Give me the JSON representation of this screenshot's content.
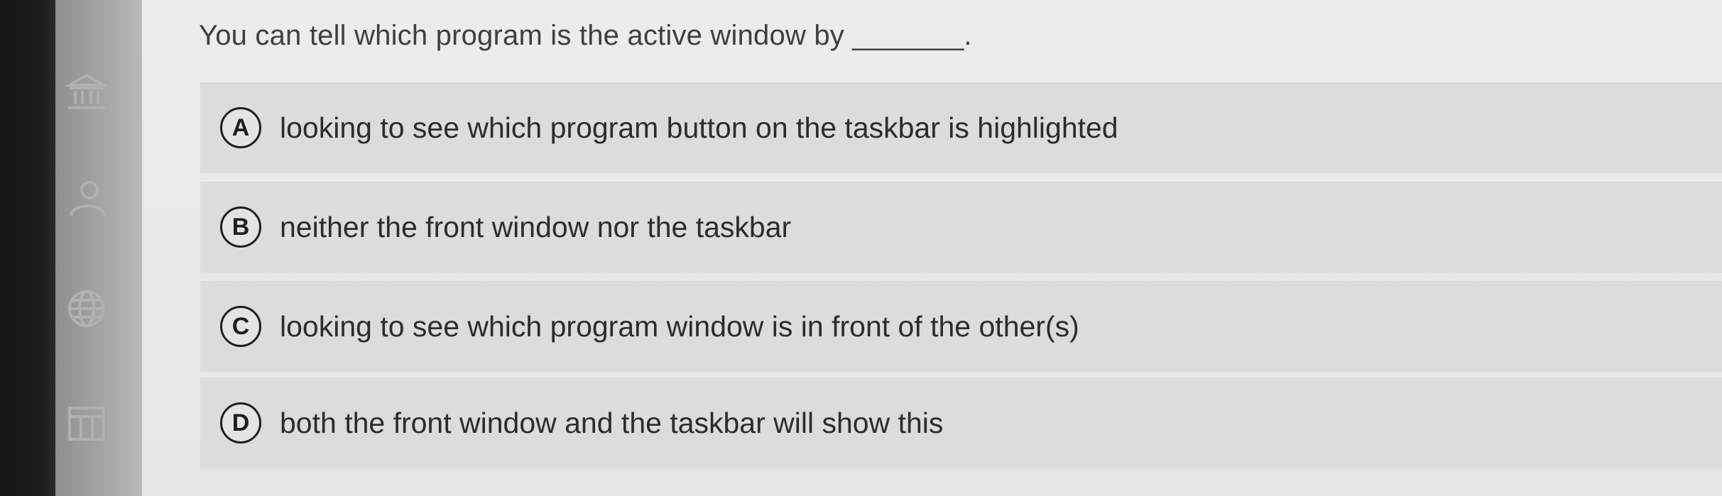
{
  "question": {
    "text": "You can tell which program is the active window by _______."
  },
  "options": [
    {
      "letter": "A",
      "text": "looking to see which program button on the taskbar is highlighted"
    },
    {
      "letter": "B",
      "text": "neither the front window nor the taskbar"
    },
    {
      "letter": "C",
      "text": "looking to see which program window is in front of the other(s)"
    },
    {
      "letter": "D",
      "text": "both the front window and the taskbar will show this"
    }
  ],
  "sidebar": {
    "icons": [
      "institution-icon",
      "user-icon",
      "globe-icon",
      "calendar-icon"
    ]
  },
  "colors": {
    "background": "#e9e9e9",
    "option_background": "#dcdcdc",
    "text": "#2c2c2c",
    "sidebar": "#a5a5a5",
    "bezel": "#1a1a1a"
  }
}
